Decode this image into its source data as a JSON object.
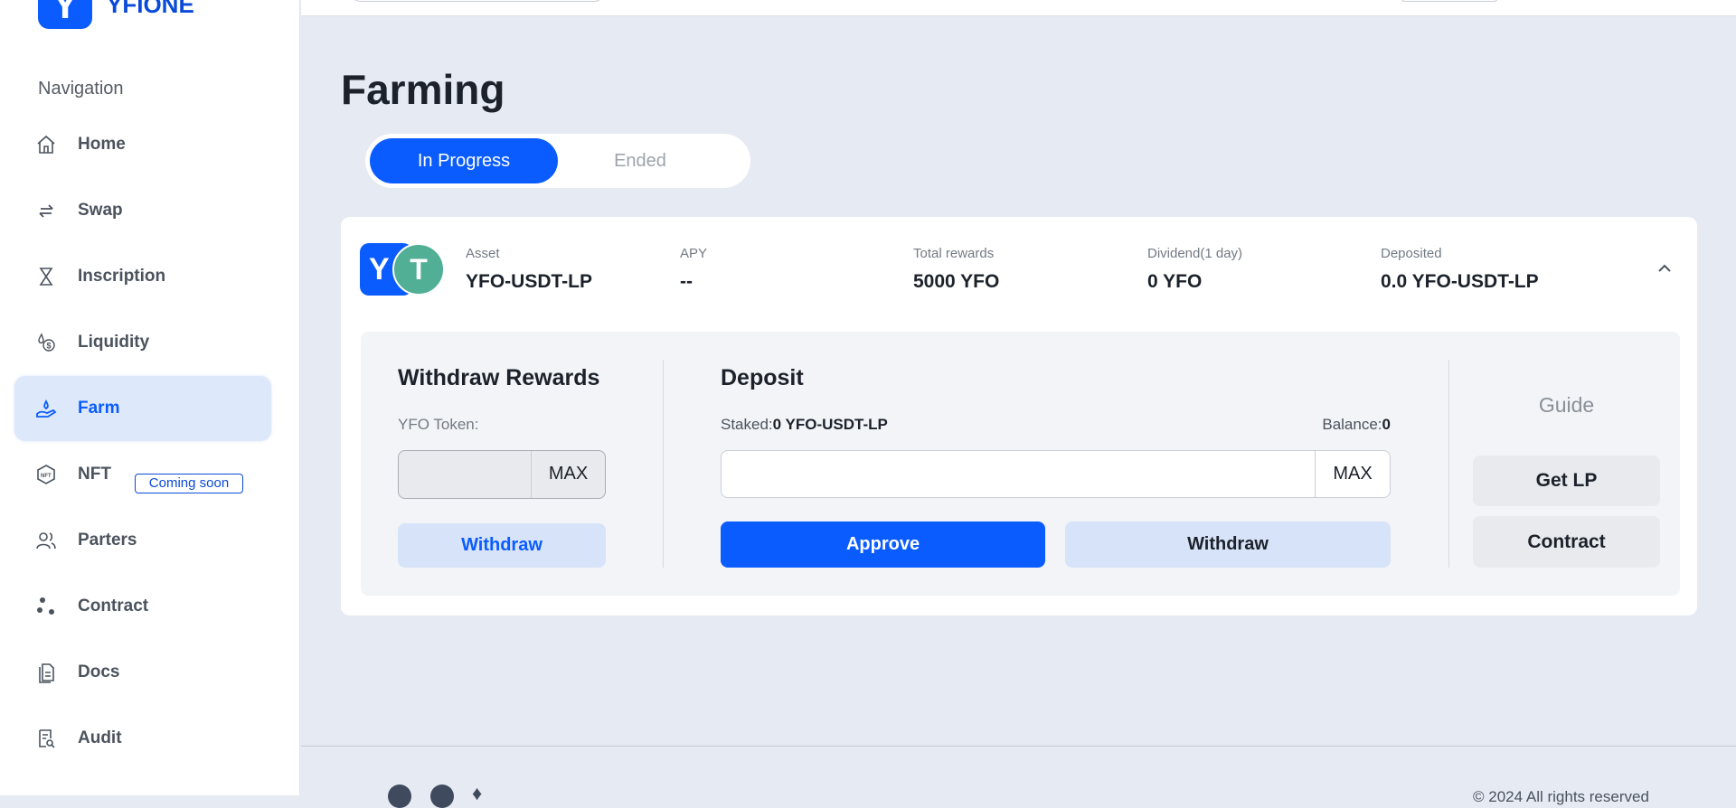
{
  "brand": {
    "name": "YFIONE",
    "logo_glyph": "Y"
  },
  "sidebar": {
    "section_label": "Navigation",
    "items": [
      {
        "label": "Home",
        "icon": "home-icon"
      },
      {
        "label": "Swap",
        "icon": "swap-icon"
      },
      {
        "label": "Inscription",
        "icon": "hourglass-icon"
      },
      {
        "label": "Liquidity",
        "icon": "liquidity-icon"
      },
      {
        "label": "Farm",
        "icon": "farm-icon",
        "active": true
      },
      {
        "label": "NFT",
        "icon": "nft-icon",
        "badge": "Coming soon"
      },
      {
        "label": "Parters",
        "icon": "users-icon"
      },
      {
        "label": "Contract",
        "icon": "contract-icon"
      },
      {
        "label": "Docs",
        "icon": "docs-icon"
      },
      {
        "label": "Audit",
        "icon": "audit-icon"
      }
    ]
  },
  "page": {
    "title": "Farming",
    "tabs": [
      {
        "label": "In Progress",
        "active": true
      },
      {
        "label": "Ended"
      }
    ]
  },
  "pool": {
    "asset_label": "Asset",
    "asset": "YFO-USDT-LP",
    "apy_label": "APY",
    "apy": "--",
    "total_label": "Total rewards",
    "total": "5000 YFO",
    "dividend_label": "Dividend(1 day)",
    "dividend": "0 YFO",
    "deposited_label": "Deposited",
    "deposited": "0.0 YFO-USDT-LP"
  },
  "withdraw": {
    "title": "Withdraw Rewards",
    "token_label": "YFO Token:",
    "input_value": "",
    "max": "MAX",
    "button": "Withdraw"
  },
  "deposit": {
    "title": "Deposit",
    "staked_label": "Staked:",
    "staked": "0 YFO-USDT-LP",
    "balance_label": "Balance:",
    "balance": "0",
    "input_value": "",
    "max": "MAX",
    "approve": "Approve",
    "withdraw": "Withdraw"
  },
  "guide": {
    "title": "Guide",
    "get_lp": "Get LP",
    "contract": "Contract"
  },
  "footer": {
    "copyright": "© 2024 All rights reserved"
  },
  "colors": {
    "accent": "#0a5cff",
    "background": "#e6eaf2",
    "tether": "#50af95"
  }
}
